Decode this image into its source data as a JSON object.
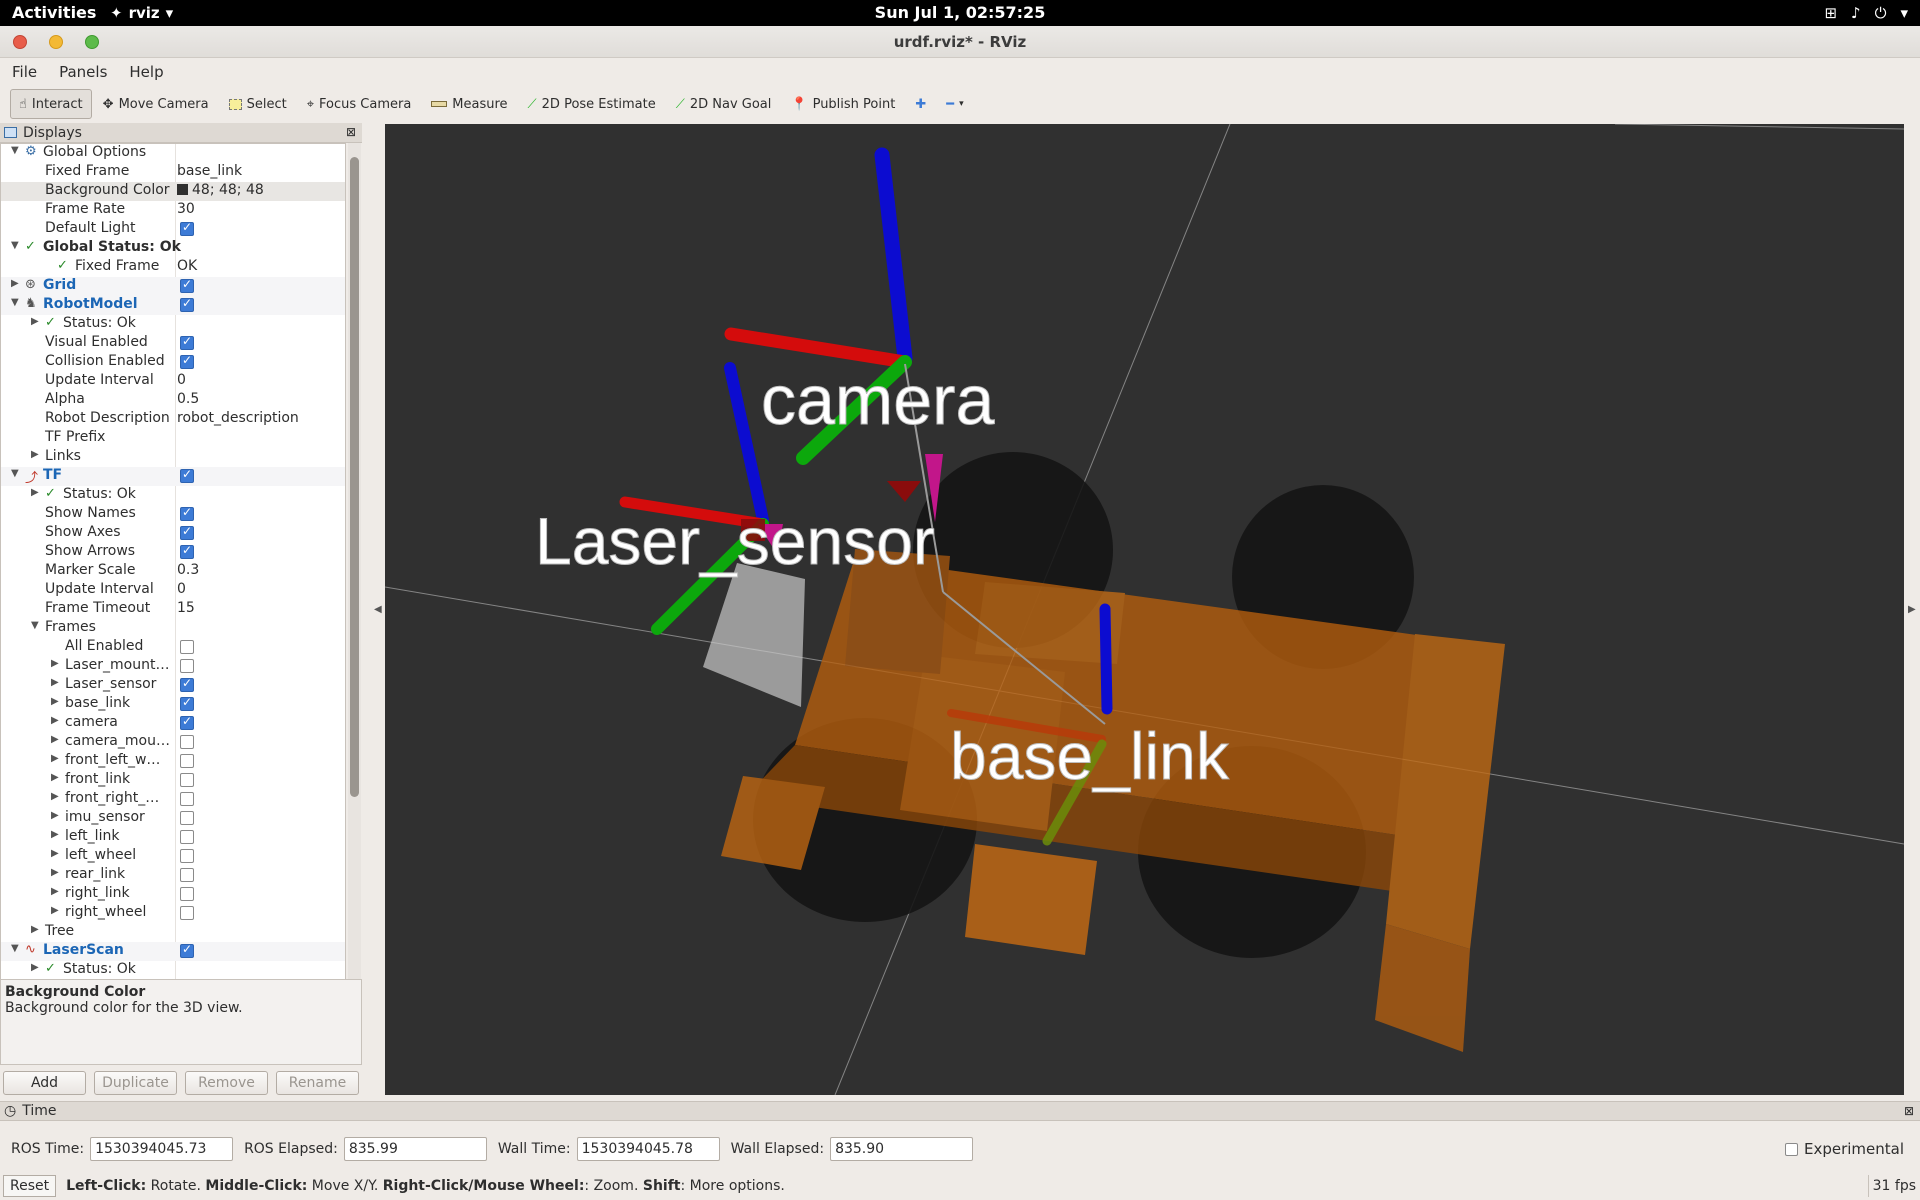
{
  "topbar": {
    "activities": "Activities",
    "app": "rviz",
    "clock": "Sun Jul  1, 02:57:25"
  },
  "window": {
    "title": "urdf.rviz* - RViz"
  },
  "menu": {
    "file": "File",
    "panels": "Panels",
    "help": "Help"
  },
  "toolbar": {
    "interact": "Interact",
    "move_camera": "Move Camera",
    "select": "Select",
    "focus_camera": "Focus Camera",
    "measure": "Measure",
    "pose_estimate": "2D Pose Estimate",
    "nav_goal": "2D Nav Goal",
    "publish_point": "Publish Point"
  },
  "displays": {
    "title": "Displays",
    "global_options": "Global Options",
    "fixed_frame_label": "Fixed Frame",
    "fixed_frame_value": "base_link",
    "bg_color_label": "Background Color",
    "bg_color_value": "48; 48; 48",
    "frame_rate_label": "Frame Rate",
    "frame_rate_value": "30",
    "default_light_label": "Default Light",
    "global_status": "Global Status: Ok",
    "fixed_frame_status": "Fixed Frame",
    "fixed_frame_status_value": "OK",
    "grid": "Grid",
    "robot_model": "RobotModel",
    "status_ok": "Status: Ok",
    "visual_enabled": "Visual Enabled",
    "collision_enabled": "Collision Enabled",
    "update_interval": "Update Interval",
    "update_interval_value": "0",
    "alpha": "Alpha",
    "alpha_value": "0.5",
    "robot_description": "Robot Description",
    "robot_description_value": "robot_description",
    "tf_prefix": "TF Prefix",
    "links": "Links",
    "tf": "TF",
    "show_names": "Show Names",
    "show_axes": "Show Axes",
    "show_arrows": "Show Arrows",
    "marker_scale": "Marker Scale",
    "marker_scale_value": "0.3",
    "tf_update_interval_value": "0",
    "frame_timeout": "Frame Timeout",
    "frame_timeout_value": "15",
    "frames": "Frames",
    "all_enabled": "All Enabled",
    "frame_list": [
      {
        "name": "Laser_mount…",
        "checked": false
      },
      {
        "name": "Laser_sensor",
        "checked": true
      },
      {
        "name": "base_link",
        "checked": true
      },
      {
        "name": "camera",
        "checked": true
      },
      {
        "name": "camera_mou…",
        "checked": false
      },
      {
        "name": "front_left_w…",
        "checked": false
      },
      {
        "name": "front_link",
        "checked": false
      },
      {
        "name": "front_right_…",
        "checked": false
      },
      {
        "name": "imu_sensor",
        "checked": false
      },
      {
        "name": "left_link",
        "checked": false
      },
      {
        "name": "left_wheel",
        "checked": false
      },
      {
        "name": "rear_link",
        "checked": false
      },
      {
        "name": "right_link",
        "checked": false
      },
      {
        "name": "right_wheel",
        "checked": false
      }
    ],
    "tree": "Tree",
    "laser_scan": "LaserScan",
    "laser_status": "Status: Ok"
  },
  "help": {
    "title": "Background Color",
    "text": "Background color for the 3D view."
  },
  "buttons": {
    "add": "Add",
    "duplicate": "Duplicate",
    "remove": "Remove",
    "rename": "Rename"
  },
  "view": {
    "label_camera": "camera",
    "label_laser": "Laser_sensor",
    "label_base": "base_link",
    "background": "#303030"
  },
  "time": {
    "title": "Time",
    "ros_time_label": "ROS Time:",
    "ros_time": "1530394045.73",
    "ros_elapsed_label": "ROS Elapsed:",
    "ros_elapsed": "835.99",
    "wall_time_label": "Wall Time:",
    "wall_time": "1530394045.78",
    "wall_elapsed_label": "Wall Elapsed:",
    "wall_elapsed": "835.90",
    "experimental": "Experimental"
  },
  "status": {
    "reset": "Reset",
    "hint_left": "Left-Click:",
    "hint_left_txt": " Rotate. ",
    "hint_middle": "Middle-Click:",
    "hint_middle_txt": " Move X/Y. ",
    "hint_right": "Right-Click/Mouse Wheel:",
    "hint_right_txt": ": Zoom. ",
    "hint_shift": "Shift",
    "hint_shift_txt": ": More options.",
    "fps": "31 fps"
  }
}
